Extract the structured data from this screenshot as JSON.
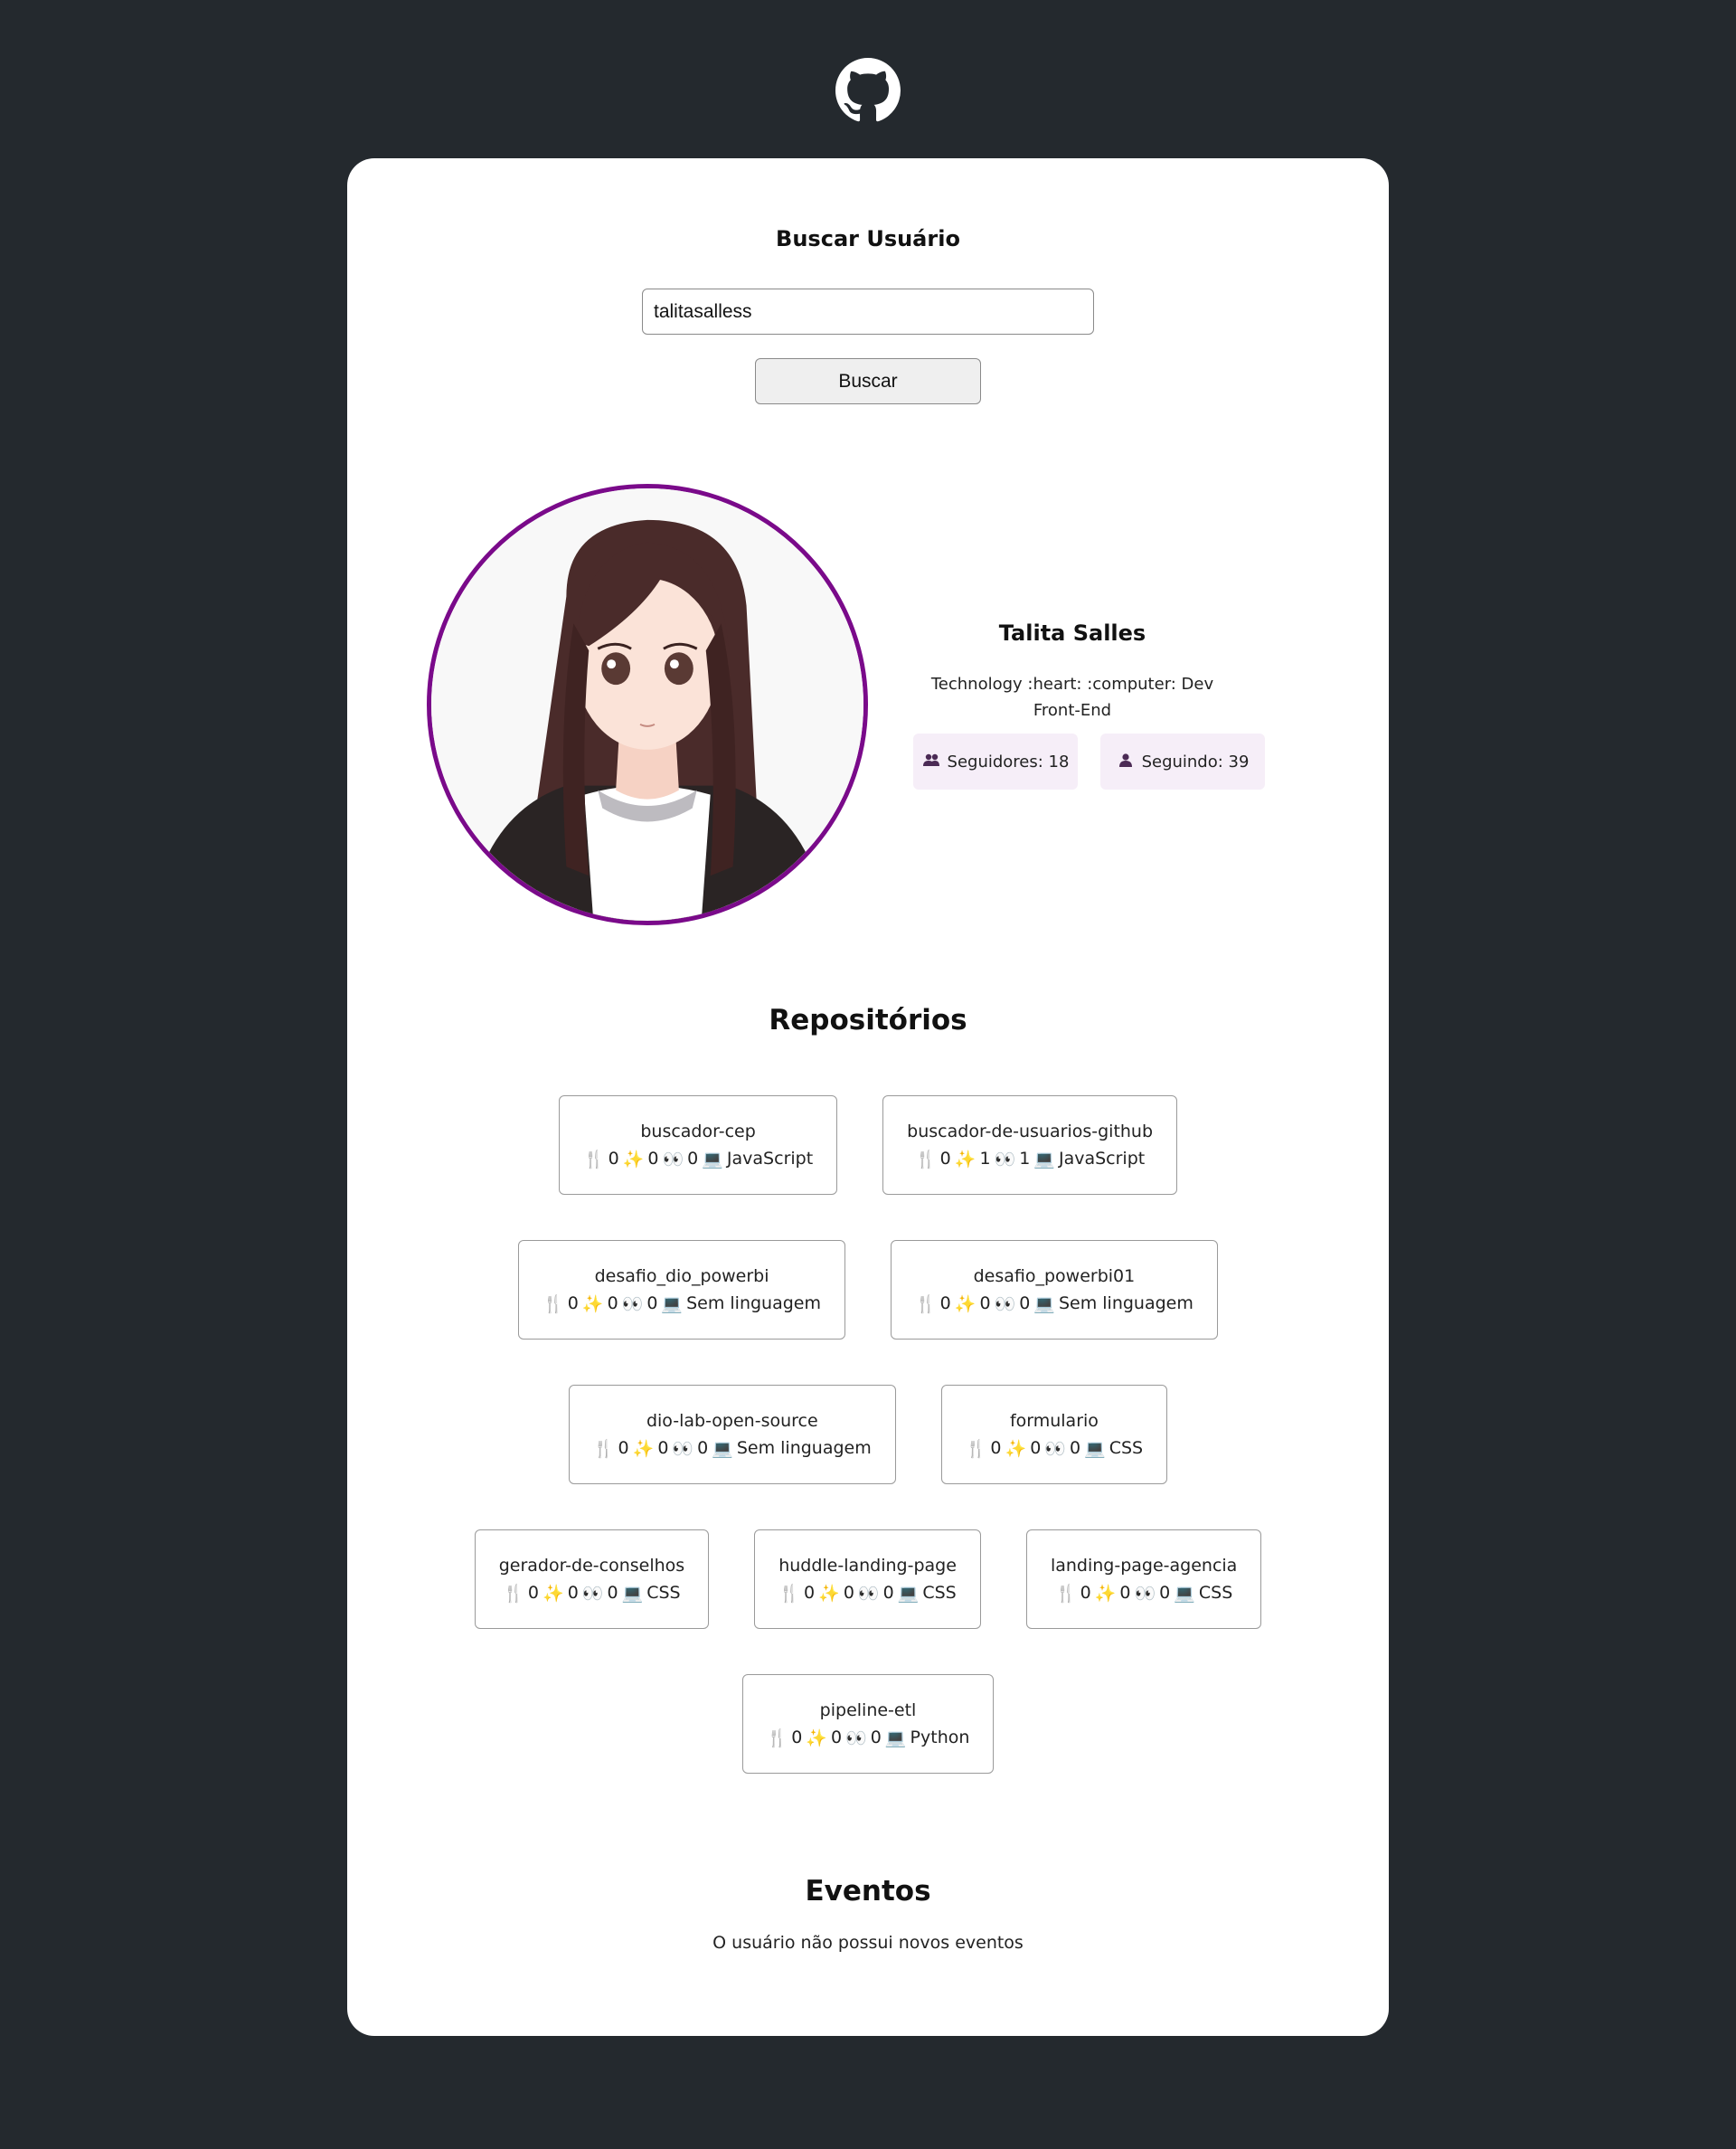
{
  "search": {
    "title": "Buscar Usuário",
    "input_value": "talitasalless",
    "button_label": "Buscar"
  },
  "profile": {
    "name": "Talita Salles",
    "bio": "Technology :heart: :computer: Dev Front-End",
    "followers_label": "Seguidores: 18",
    "following_label": "Seguindo: 39"
  },
  "repositories": {
    "title": "Repositórios",
    "rows": [
      [
        {
          "name": "buscador-cep",
          "forks": "0",
          "stars": "0",
          "watchers": "0",
          "language": "JavaScript"
        },
        {
          "name": "buscador-de-usuarios-github",
          "forks": "0",
          "stars": "1",
          "watchers": "1",
          "language": "JavaScript"
        }
      ],
      [
        {
          "name": "desafio_dio_powerbi",
          "forks": "0",
          "stars": "0",
          "watchers": "0",
          "language": "Sem linguagem"
        },
        {
          "name": "desafio_powerbi01",
          "forks": "0",
          "stars": "0",
          "watchers": "0",
          "language": "Sem linguagem"
        }
      ],
      [
        {
          "name": "dio-lab-open-source",
          "forks": "0",
          "stars": "0",
          "watchers": "0",
          "language": "Sem linguagem"
        },
        {
          "name": "formulario",
          "forks": "0",
          "stars": "0",
          "watchers": "0",
          "language": "CSS"
        }
      ],
      [
        {
          "name": "gerador-de-conselhos",
          "forks": "0",
          "stars": "0",
          "watchers": "0",
          "language": "CSS"
        },
        {
          "name": "huddle-landing-page",
          "forks": "0",
          "stars": "0",
          "watchers": "0",
          "language": "CSS"
        },
        {
          "name": "landing-page-agencia",
          "forks": "0",
          "stars": "0",
          "watchers": "0",
          "language": "CSS"
        }
      ],
      [
        {
          "name": "pipeline-etl",
          "forks": "0",
          "stars": "0",
          "watchers": "0",
          "language": "Python"
        }
      ]
    ]
  },
  "events": {
    "title": "Eventos",
    "empty_message": "O usuário não possui novos eventos"
  },
  "icons": {
    "logo": "github-octocat-icon",
    "fork": "fork-knife-icon",
    "star": "sparkles-icon",
    "watch": "eyes-icon",
    "language": "computer-icon",
    "followers": "people-icon",
    "following": "person-icon"
  },
  "colors": {
    "background": "#24292e",
    "card": "#ffffff",
    "avatar_border": "#7a0a8a",
    "stat_bg": "#f6eef8",
    "stat_icon": "#4b2a55"
  }
}
